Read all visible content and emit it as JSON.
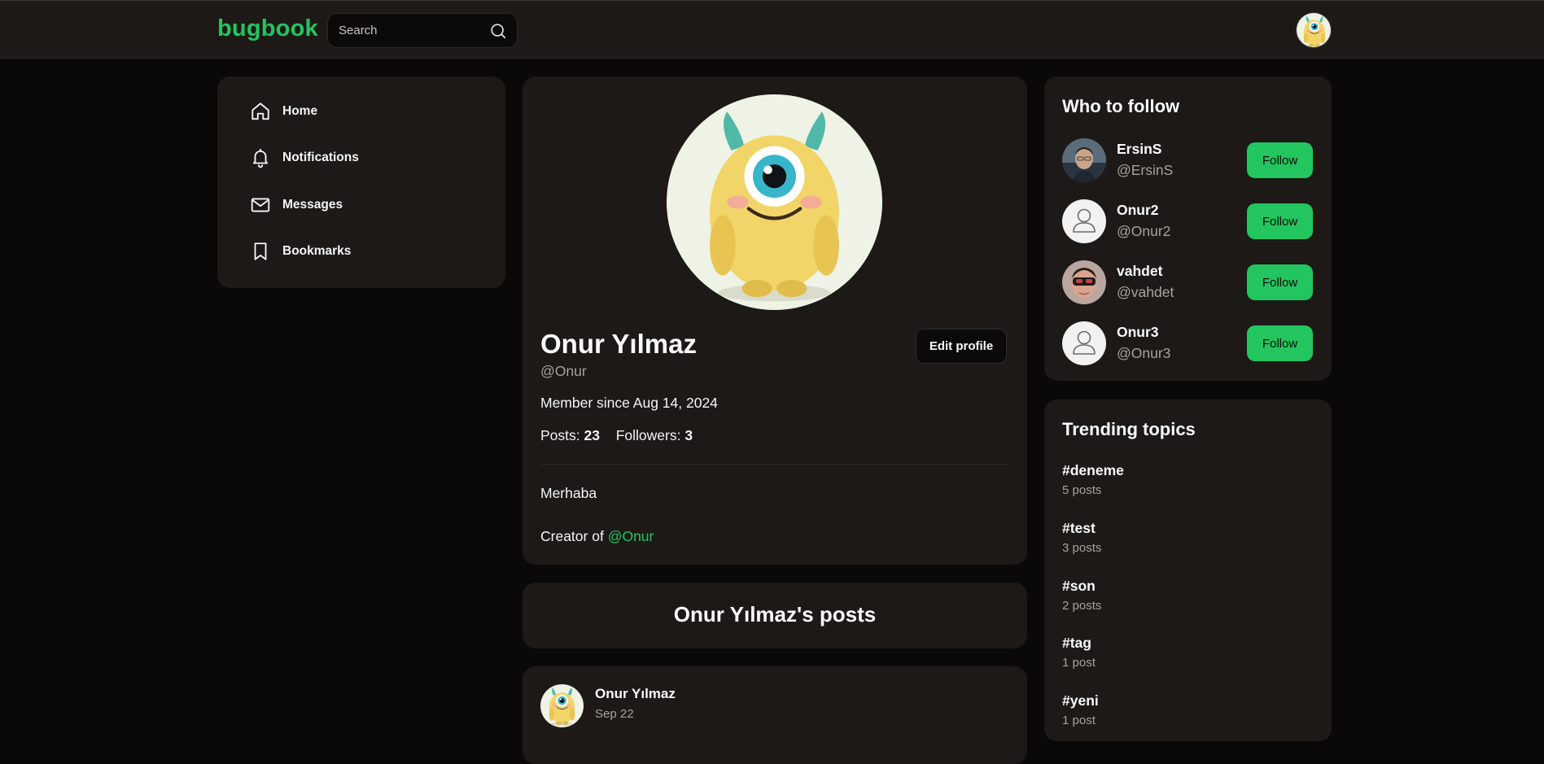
{
  "app": {
    "logo": "bugbook"
  },
  "search": {
    "placeholder": "Search"
  },
  "nav": {
    "items": [
      {
        "label": "Home",
        "icon": "home-icon"
      },
      {
        "label": "Notifications",
        "icon": "bell-icon"
      },
      {
        "label": "Messages",
        "icon": "mail-icon"
      },
      {
        "label": "Bookmarks",
        "icon": "bookmark-icon"
      }
    ]
  },
  "profile": {
    "name": "Onur Yılmaz",
    "handle": "@Onur",
    "edit_label": "Edit profile",
    "member_since": "Member since Aug 14, 2024",
    "posts_label": "Posts:",
    "posts_count": "23",
    "followers_label": "Followers:",
    "followers_count": "3",
    "bio_line1": "Merhaba",
    "bio_line2_prefix": "Creator of",
    "bio_line2_mention": "@Onur"
  },
  "posts_section": {
    "title": "Onur Yılmaz's posts"
  },
  "first_post": {
    "author": "Onur Yılmaz",
    "date": "Sep 22"
  },
  "who_to_follow": {
    "title": "Who to follow",
    "users": [
      {
        "name": "ErsinS",
        "handle": "@ErsinS",
        "button": "Follow",
        "avatar": "photo"
      },
      {
        "name": "Onur2",
        "handle": "@Onur2",
        "button": "Follow",
        "avatar": "placeholder"
      },
      {
        "name": "vahdet",
        "handle": "@vahdet",
        "button": "Follow",
        "avatar": "photo"
      },
      {
        "name": "Onur3",
        "handle": "@Onur3",
        "button": "Follow",
        "avatar": "placeholder"
      }
    ]
  },
  "trending": {
    "title": "Trending topics",
    "topics": [
      {
        "tag": "#deneme",
        "count": "5 posts"
      },
      {
        "tag": "#test",
        "count": "3 posts"
      },
      {
        "tag": "#son",
        "count": "2 posts"
      },
      {
        "tag": "#tag",
        "count": "1 post"
      },
      {
        "tag": "#yeni",
        "count": "1 post"
      }
    ]
  },
  "colors": {
    "accent": "#22c55e",
    "card": "#1c1917",
    "background": "#0b0908",
    "muted": "#a8a29e"
  }
}
